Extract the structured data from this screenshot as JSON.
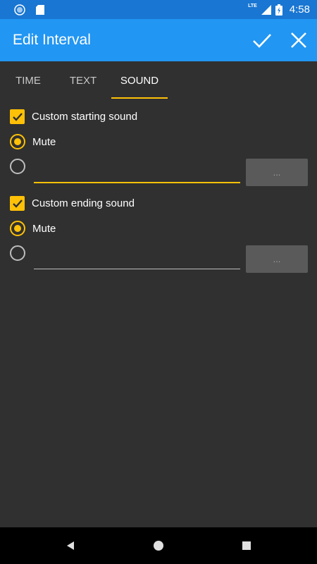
{
  "status_bar": {
    "time": "4:58",
    "network": "LTE",
    "icons": [
      "app-notification-icon",
      "sd-card-icon",
      "signal-icon",
      "battery-charging-icon"
    ]
  },
  "app_bar": {
    "title": "Edit Interval",
    "confirm_icon": "check-icon",
    "close_icon": "close-icon"
  },
  "tabs": [
    {
      "label": "TIME",
      "active": false
    },
    {
      "label": "TEXT",
      "active": false
    },
    {
      "label": "SOUND",
      "active": true
    }
  ],
  "starting_sound": {
    "checkbox_label": "Custom starting sound",
    "checked": true,
    "mute_label": "Mute",
    "mute_selected": true,
    "file_value": "",
    "browse_label": "..."
  },
  "ending_sound": {
    "checkbox_label": "Custom ending sound",
    "checked": true,
    "mute_label": "Mute",
    "mute_selected": true,
    "file_value": "",
    "browse_label": "..."
  },
  "nav_bar": {
    "icons": [
      "back-icon",
      "home-icon",
      "recents-icon"
    ]
  },
  "colors": {
    "status_bar": "#1976d2",
    "app_bar": "#2196f3",
    "accent": "#ffc107",
    "background": "#303030"
  }
}
